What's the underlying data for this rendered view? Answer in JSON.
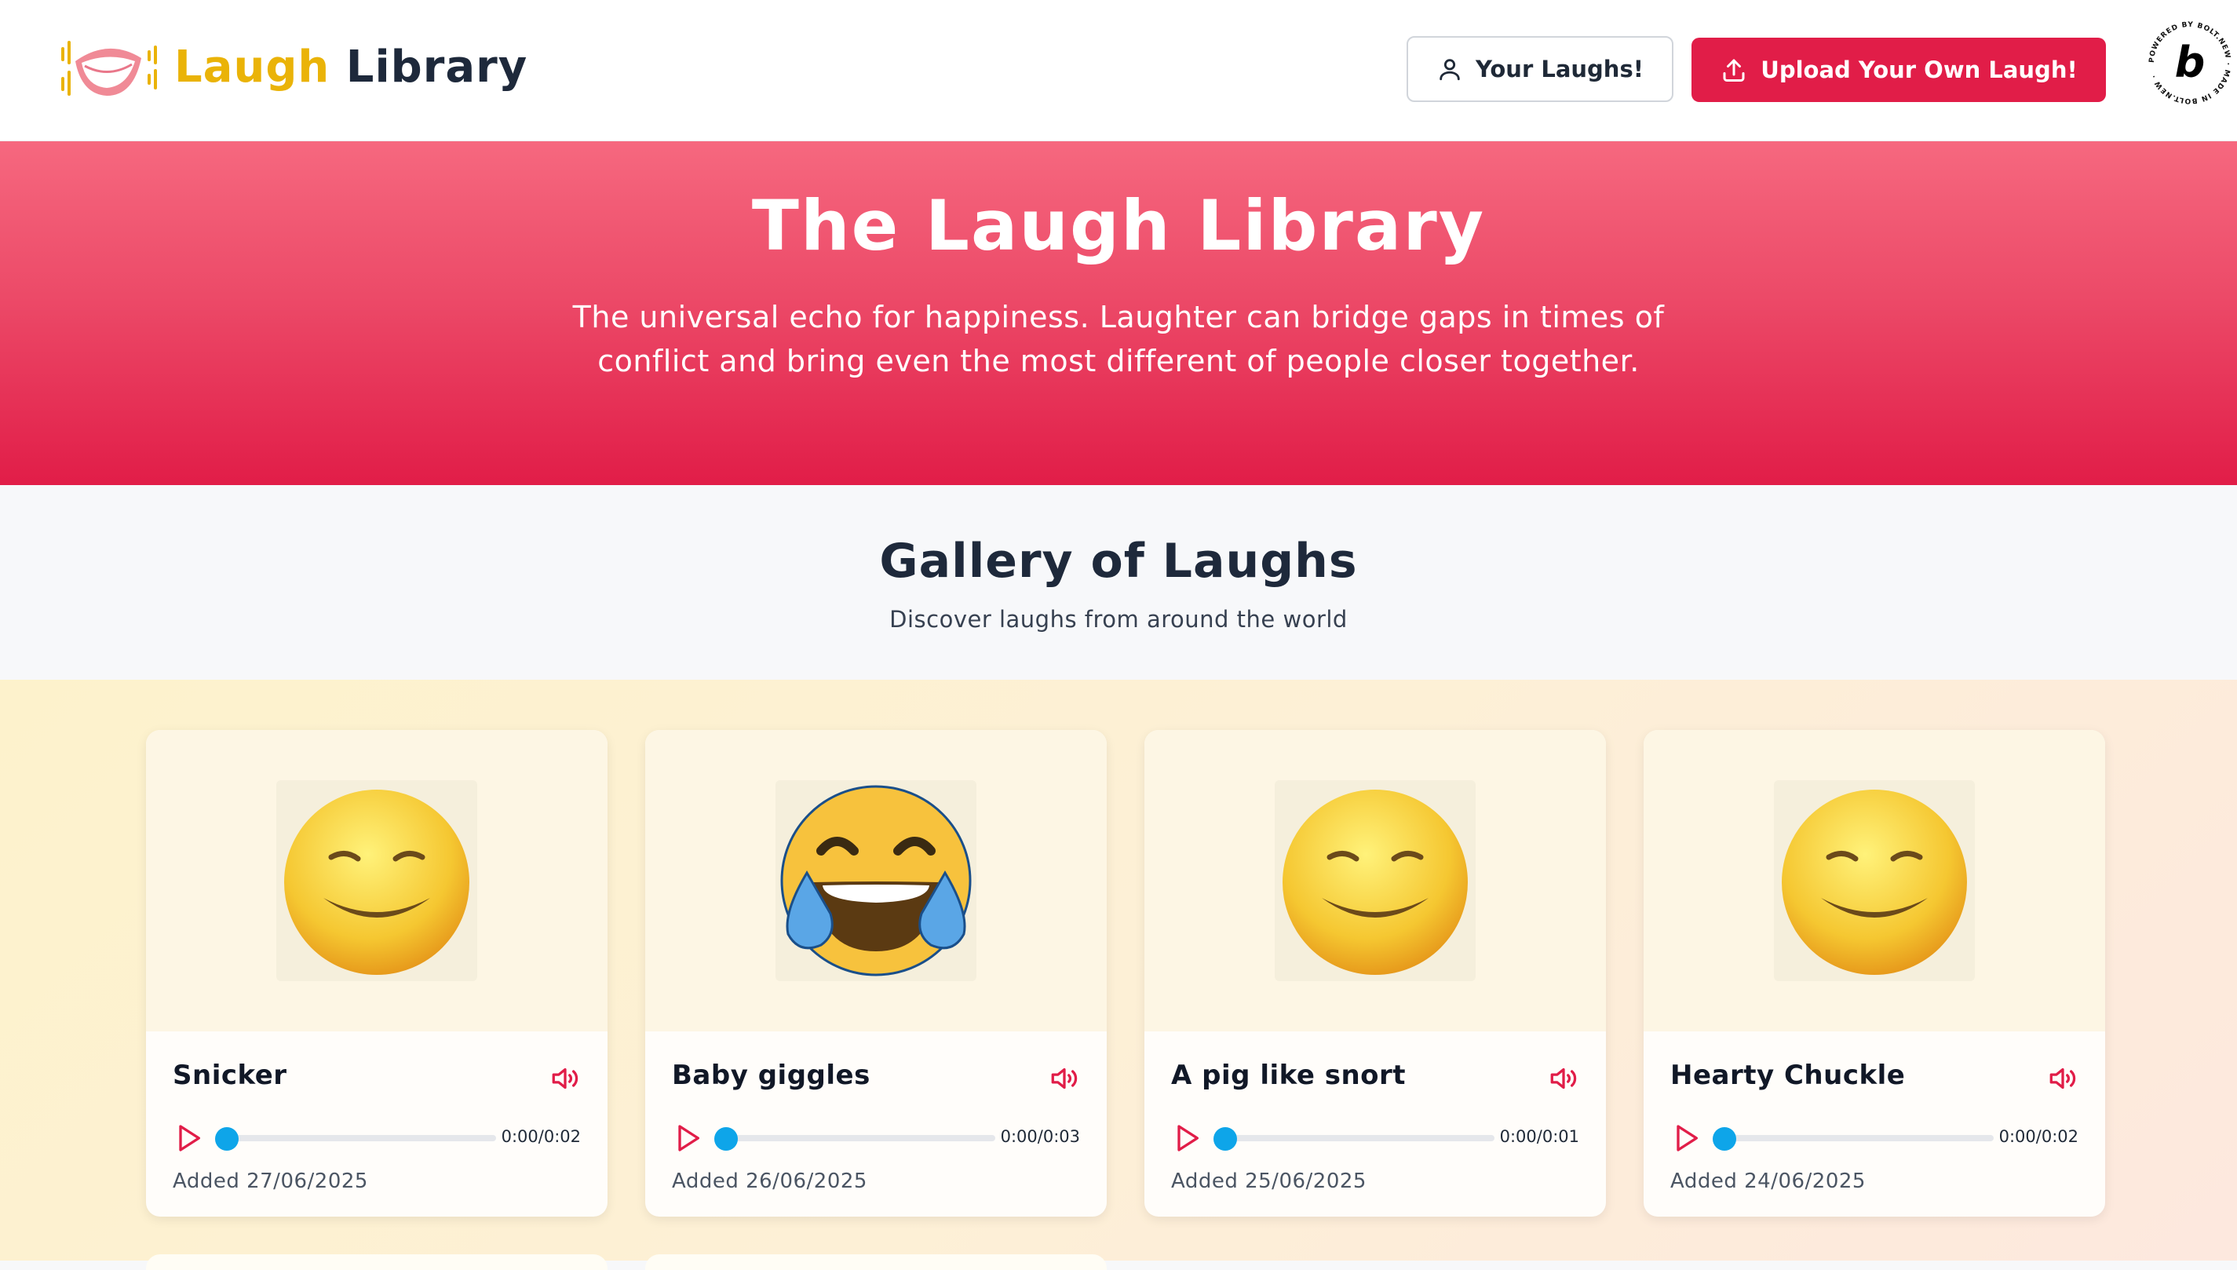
{
  "header": {
    "logo_word1": "Laugh",
    "logo_word2": "Library",
    "your_laughs_label": "Your Laughs!",
    "upload_label": "Upload Your Own Laugh!",
    "badge_text": "POWERED BY BOLT.NEW · MADE IN BOLT.NEW ·",
    "badge_letter": "b"
  },
  "hero": {
    "title": "The Laugh Library",
    "subtitle": "The universal echo for happiness. Laughter can bridge gaps in times of conflict and bring even the most different of people closer together."
  },
  "gallery": {
    "title": "Gallery of Laughs",
    "subtitle": "Discover laughs from around the world"
  },
  "cards": [
    {
      "title": "Snicker",
      "time": "0:00/0:02",
      "added": "Added 27/06/2025",
      "emoji": "smiling-face-icon"
    },
    {
      "title": "Baby giggles",
      "time": "0:00/0:03",
      "added": "Added 26/06/2025",
      "emoji": "tears-of-joy-icon"
    },
    {
      "title": "A pig like snort",
      "time": "0:00/0:01",
      "added": "Added 25/06/2025",
      "emoji": "smiling-face-icon"
    },
    {
      "title": "Hearty Chuckle",
      "time": "0:00/0:02",
      "added": "Added 24/06/2025",
      "emoji": "smiling-face-icon"
    }
  ],
  "colors": {
    "brand": "#e11d48",
    "logo_yellow": "#eab308",
    "progress_knob": "#0ea5e9"
  }
}
